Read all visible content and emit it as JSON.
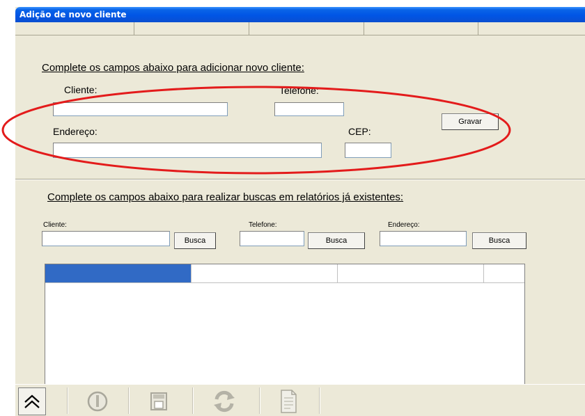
{
  "window": {
    "title": "Adição de novo cliente"
  },
  "add_section": {
    "heading": "Complete os campos abaixo para adicionar novo cliente:",
    "cliente_label": "Cliente:",
    "telefone_label": "Telefone:",
    "endereco_label": "Endereço:",
    "cep_label": "CEP:",
    "cliente_value": "",
    "telefone_value": "",
    "endereco_value": "",
    "cep_value": "",
    "save_label": "Gravar"
  },
  "search_section": {
    "heading": "Complete os campos abaixo para realizar buscas em relatórios já existentes:",
    "cliente_label": "Cliente:",
    "telefone_label": "Telefone:",
    "endereco_label": "Endereço:",
    "cliente_value": "",
    "telefone_value": "",
    "endereco_value": "",
    "search_label": "Busca"
  },
  "colors": {
    "titlebar": "#0055e5",
    "window_bg": "#ece9d8",
    "highlight_oval": "#e31b1b",
    "selected_cell": "#316ac5"
  },
  "toolbar": {
    "icons": [
      "double-chevron-up-icon",
      "power-icon",
      "save-icon",
      "refresh-icon",
      "document-icon"
    ]
  }
}
